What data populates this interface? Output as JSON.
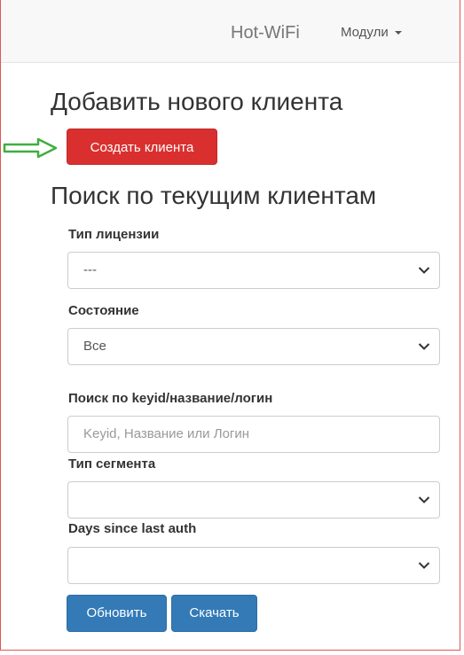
{
  "navbar": {
    "brand": "Hot-WiFi",
    "modules_label": "Модули"
  },
  "add_section": {
    "title": "Добавить нового клиента",
    "create_button": "Создать клиента"
  },
  "search_section": {
    "title": "Поиск по текущим клиентам",
    "license_type": {
      "label": "Тип лицензии",
      "value": "---"
    },
    "state": {
      "label": "Состояние",
      "value": "Все"
    },
    "query": {
      "label": "Поиск по keyid/название/логин",
      "placeholder": "Keyid, Название или Логин",
      "value": ""
    },
    "segment_type": {
      "label": "Тип сегмента",
      "value": ""
    },
    "days_since_auth": {
      "label": "Days since last auth",
      "value": ""
    },
    "refresh_button": "Обновить",
    "download_button": "Скачать"
  },
  "colors": {
    "danger": "#d9302f",
    "primary": "#337ab7",
    "arrow": "#3fae3f",
    "frame": "#e05656"
  }
}
